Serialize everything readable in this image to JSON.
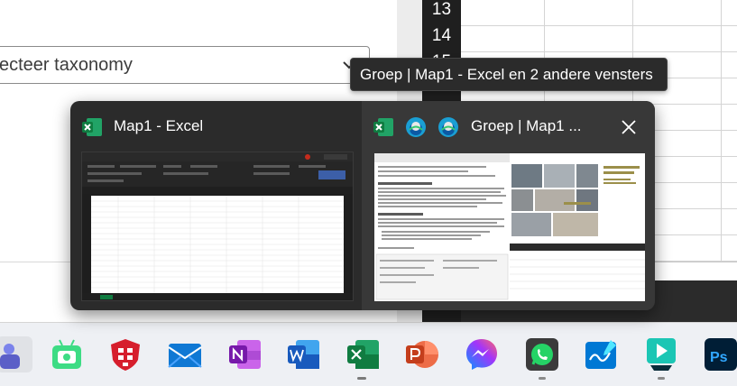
{
  "background_page": {
    "taxonomy_select": {
      "value": "ecteer taxonomy"
    }
  },
  "excel_bg": {
    "row_numbers": [
      "13",
      "14",
      "15"
    ]
  },
  "tooltip": {
    "text": "Groep | Map1 - Excel en 2 andere vensters"
  },
  "flyout": {
    "thumbnails": [
      {
        "title": "Map1 - Excel",
        "icons": [
          "excel-icon"
        ]
      },
      {
        "title": "Groep | Map1 ...",
        "icons": [
          "excel-icon",
          "edge-icon",
          "edge-icon"
        ]
      }
    ],
    "close_icon": "close-icon"
  },
  "taskbar": {
    "items": [
      {
        "name": "teams-icon",
        "color": "#5b5fc7"
      },
      {
        "name": "android-icon",
        "color": "#3ddc84"
      },
      {
        "name": "fortinet-icon",
        "color": "#d61e2c"
      },
      {
        "name": "mail-icon",
        "color": "#0f78d4"
      },
      {
        "name": "onenote-icon",
        "color": "#7719aa"
      },
      {
        "name": "word-icon",
        "color": "#185abd"
      },
      {
        "name": "excel-icon",
        "color": "#107c41"
      },
      {
        "name": "powerpoint-icon",
        "color": "#c43e1c"
      },
      {
        "name": "messenger-icon",
        "color": "#a334fa"
      },
      {
        "name": "whatsapp-icon",
        "color": "#25d366"
      },
      {
        "name": "whiteboard-icon",
        "color": "#0078d4"
      },
      {
        "name": "filmora-icon",
        "color": "#1bc6b4"
      },
      {
        "name": "photoshop-icon",
        "color": "#31a8ff"
      }
    ]
  }
}
